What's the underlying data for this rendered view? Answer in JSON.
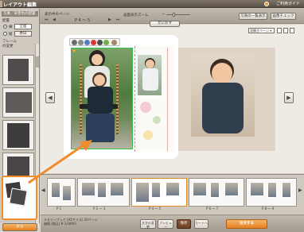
{
  "window": {
    "title": "レイアウト編集",
    "help": "ご利用ガイド"
  },
  "toolbar": {
    "display_page_label": "表示中のページ",
    "page_indicator": "P 4 ～ 5",
    "zoom_label": "画面表示ズーム",
    "btn_photo_list": "写真の一覧表示",
    "btn_image_check": "画像チェック"
  },
  "left_panel": {
    "header": "写真／背景色の配置",
    "line1": "配置",
    "opt_horizontal": "横",
    "opt_vertical": "縦",
    "toggle_a": "全面",
    "toggle_b": "余白",
    "frame_label": "フレーム",
    "frame_label2": "の変更"
  },
  "canvas": {
    "center_btn": "元に戻す",
    "page_select": "見開きページ",
    "nav_left": "◀",
    "nav_right": "▶"
  },
  "filmstrip": {
    "labels": [
      "P 1",
      "P 2 ～ 3",
      "P 4 ～ 5",
      "P 6 ～ 7",
      "P 8 ～ 9"
    ]
  },
  "status": {
    "line1": "メモリーブック (A5サイズ) 20ページ",
    "line2": "価格 (税込) ¥ 3,000円"
  },
  "bottom_buttons": {
    "text_edit": "文字の変更",
    "preview": "プレビュー",
    "save": "保存",
    "order": "注文する",
    "back": "戻る",
    "cart": "カートへ"
  },
  "colors": {
    "accent": "#f08c2a",
    "selection": "#3ac14a"
  }
}
